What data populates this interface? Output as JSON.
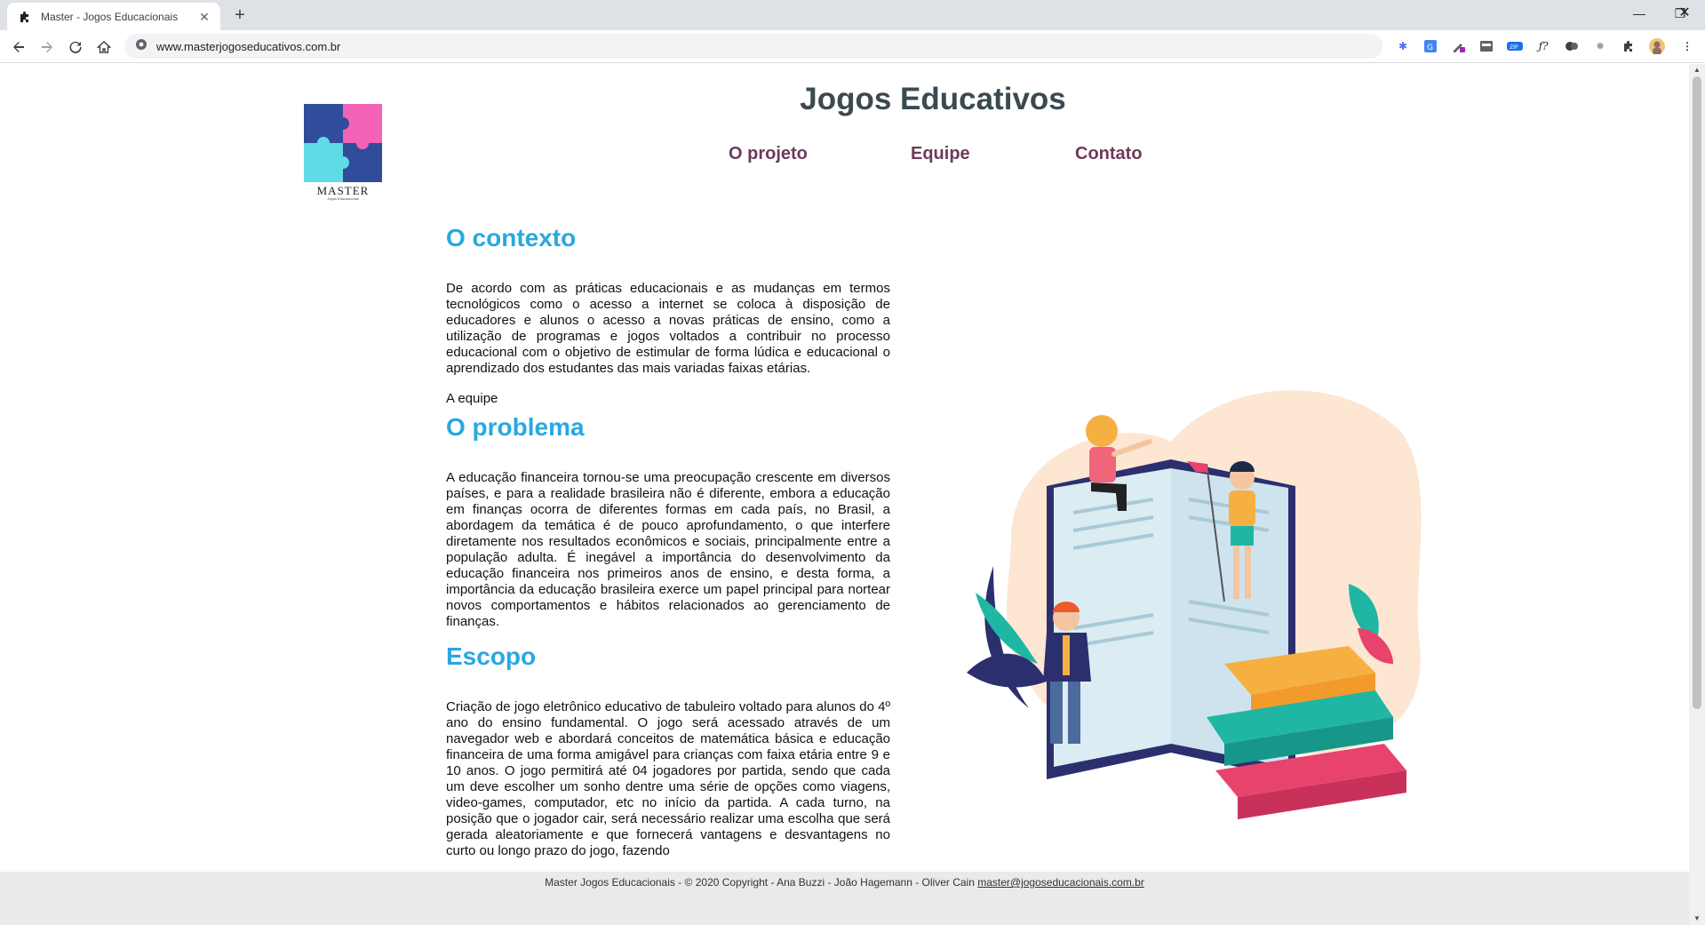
{
  "browser": {
    "tab_title": "Master - Jogos Educacionais",
    "url": "www.masterjogoseducativos.com.br"
  },
  "site": {
    "logo_word": "MASTER",
    "logo_sub": "Jogos Educacionais",
    "title": "Jogos Educativos",
    "nav": [
      "O projeto",
      "Equipe",
      "Contato"
    ]
  },
  "sections": {
    "contexto_title": "O contexto",
    "contexto_text": "De acordo com as práticas educacionais e as mudanças em termos tecnológicos como o acesso a internet se coloca à disposição de educadores e alunos o acesso a novas práticas de ensino, como a utilização de programas e jogos voltados a contribuir no processo educacional com o objetivo de estimular de forma lúdica e educacional o aprendizado dos estudantes das mais variadas faixas etárias.",
    "equipe_text": "A equipe",
    "problema_title": "O problema",
    "problema_text": "A educação financeira tornou-se uma preocupação crescente em diversos países, e para a realidade brasileira não é diferente, embora a educação em finanças ocorra de diferentes formas em cada país, no Brasil, a abordagem da temática é de pouco aprofundamento, o que interfere diretamente nos resultados econômicos e sociais, principalmente entre a população adulta. É inegável a importância do desenvolvimento da educação financeira nos primeiros anos de ensino, e desta forma, a importância da educação brasileira exerce um papel principal para nortear novos comportamentos e hábitos relacionados ao gerenciamento de finanças.",
    "escopo_title": "Escopo",
    "escopo_text": "Criação de jogo eletrônico educativo de tabuleiro voltado para alunos do 4º ano do ensino fundamental. O jogo será acessado através de um navegador web e abordará conceitos de matemática básica e educação financeira de uma forma amigável para crianças com faixa etária entre 9 e 10 anos. O jogo permitirá até 04 jogadores por partida, sendo que cada um deve escolher um sonho dentre uma série de opções como viagens, video-games, computador, etc no início da partida. A cada turno, na posição que o jogador cair, será necessário realizar uma escolha que será gerada aleatoriamente e que fornecerá vantagens e desvantagens no curto ou longo prazo do jogo, fazendo"
  },
  "footer": {
    "text": "Master Jogos Educacionais - © 2020 Copyright - Ana Buzzi - João Hagemann - Oliver Cain",
    "email": "master@jogoseducacionais.com.br"
  }
}
